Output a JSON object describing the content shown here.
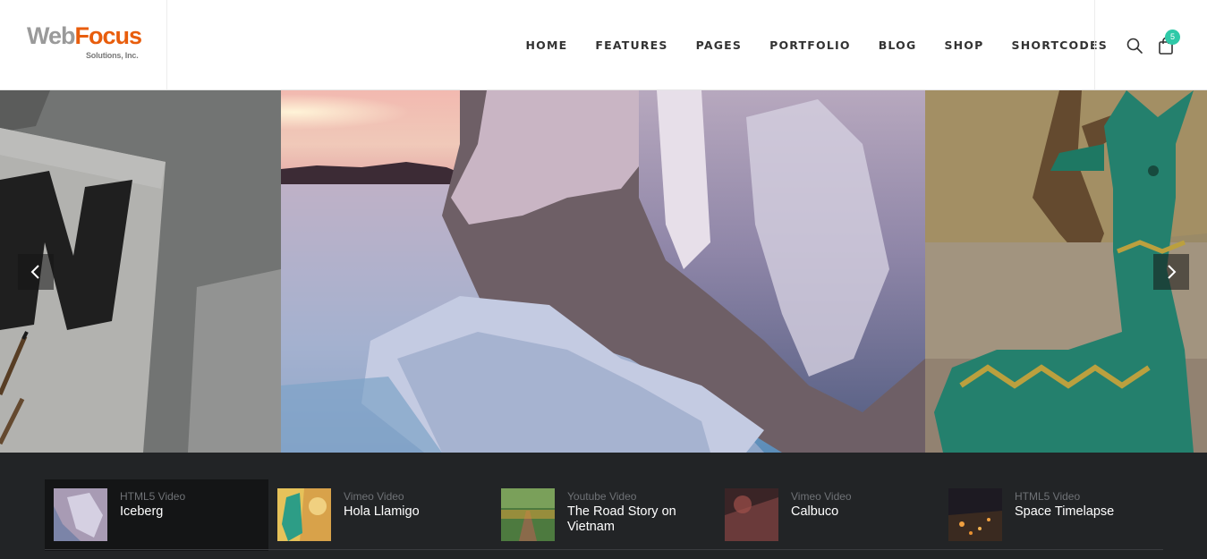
{
  "brand": {
    "name_part1": "Web",
    "name_part2": "Focus",
    "tagline": "Solutions, Inc."
  },
  "nav": {
    "items": [
      "HOME",
      "FEATURES",
      "PAGES",
      "PORTFOLIO",
      "BLOG",
      "SHOP",
      "SHORTCODES"
    ]
  },
  "header_icons": {
    "search": "search-icon",
    "cart": "shopping-bag-icon",
    "cart_count": "5"
  },
  "colors": {
    "accent": "#e85d0c",
    "badge": "#2fc9a8",
    "playlist_bg": "#222426"
  },
  "slider": {
    "prev": "chevron-left-icon",
    "next": "chevron-right-icon"
  },
  "playlist": [
    {
      "type": "HTML5 Video",
      "title": "Iceberg",
      "active": true
    },
    {
      "type": "Vimeo Video",
      "title": "Hola Llamigo",
      "active": false
    },
    {
      "type": "Youtube Video",
      "title": "The Road Story on Vietnam",
      "active": false
    },
    {
      "type": "Vimeo Video",
      "title": "Calbuco",
      "active": false
    },
    {
      "type": "HTML5 Video",
      "title": "Space Timelapse",
      "active": false
    }
  ]
}
